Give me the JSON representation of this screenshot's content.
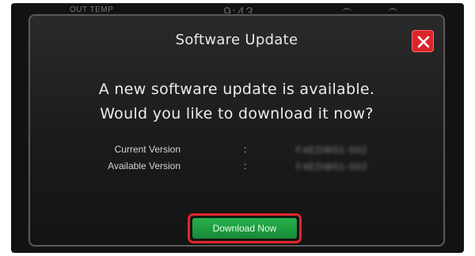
{
  "statusbar": {
    "out_temp_label": "OUT TEMP",
    "clock": "9:43"
  },
  "dialog": {
    "title": "Software Update",
    "message_line1": "A new software update is available.",
    "message_line2": "Would you like to download it now?",
    "current_version_label": "Current Version",
    "current_version_value": "F4EDW01-002",
    "available_version_label": "Available Version",
    "available_version_value": "F4EDW01-002",
    "separator": ":",
    "download_button_label": "Download Now"
  },
  "colors": {
    "close_button": "#d8262c",
    "download_button": "#1f9e42",
    "highlight_outline": "#e0262c",
    "dialog_border": "#585858"
  },
  "icons": {
    "close": "close-icon"
  }
}
